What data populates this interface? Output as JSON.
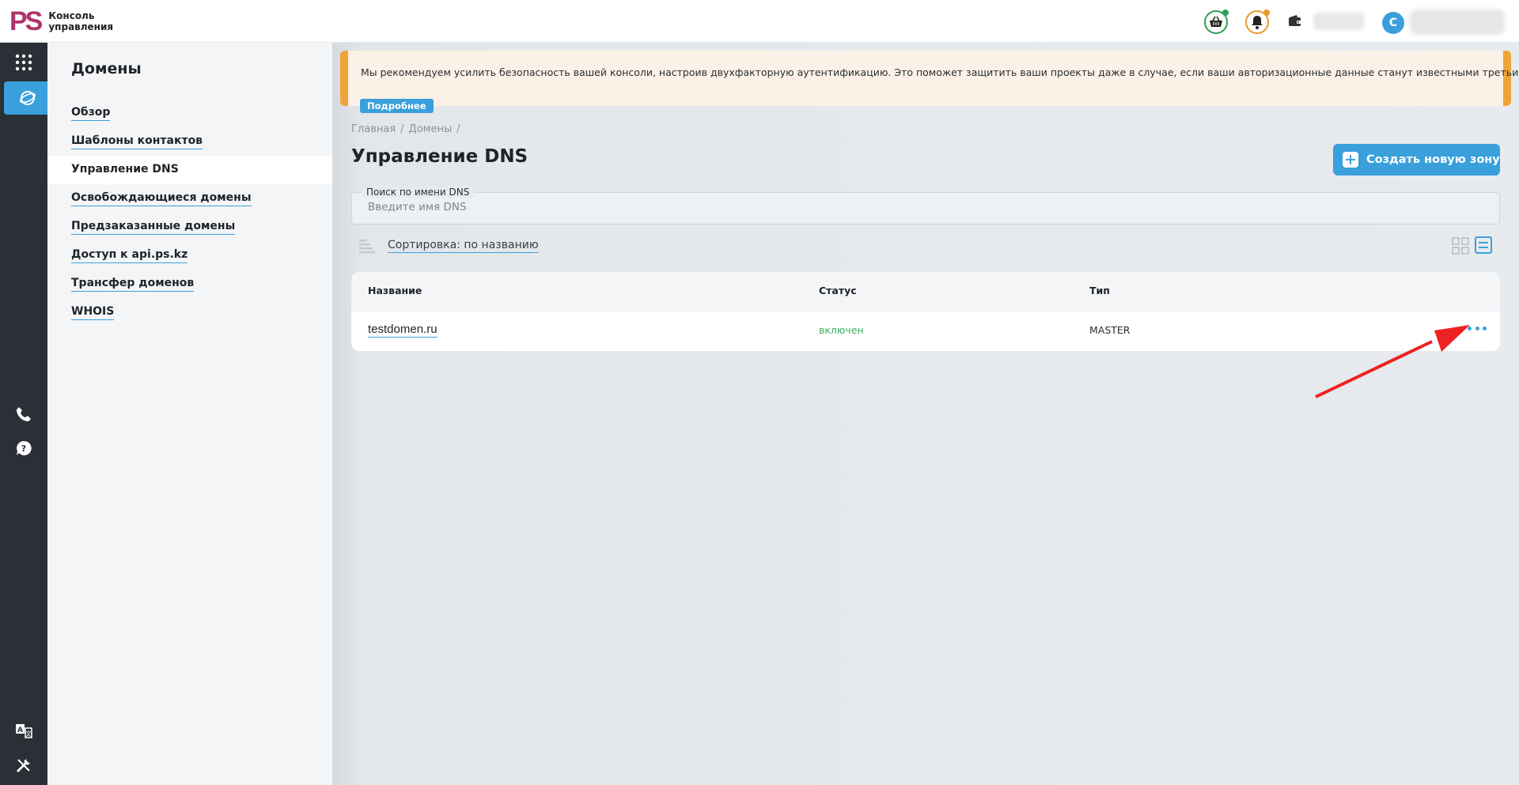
{
  "header": {
    "logo_mark": "PS",
    "logo_line1": "Консоль",
    "logo_line2": "управления",
    "avatar_initial": "С",
    "icons": [
      "basket-icon",
      "bell-icon",
      "wallet-icon"
    ],
    "basket_badge_color": "#2f9e55",
    "bell_badge_color": "#e89a2b"
  },
  "rail": {
    "items": [
      "apps-grid-icon",
      "domains-globe-icon",
      "phone-icon",
      "help-icon",
      "translate-icon",
      "tools-icon"
    ]
  },
  "sidebar": {
    "title": "Домены",
    "items": [
      {
        "label": "Обзор"
      },
      {
        "label": "Шаблоны контактов"
      },
      {
        "label": "Управление DNS",
        "active": true
      },
      {
        "label": "Освобождающиеся домены"
      },
      {
        "label": "Предзаказанные домены"
      },
      {
        "label": "Доступ к api.ps.kz"
      },
      {
        "label": "Трансфер доменов"
      },
      {
        "label": "WHOIS"
      }
    ]
  },
  "banner": {
    "text": "Мы рекомендуем усилить безопасность вашей консоли, настроив двухфакторную аутентификацию. Это поможет защитить ваши проекты даже в случае, если ваши авторизационные данные станут известными третьим лицам.",
    "button": "Подробнее"
  },
  "breadcrumb": {
    "items": [
      "Главная",
      "Домены"
    ]
  },
  "page": {
    "title": "Управление DNS",
    "create_button": "Создать новую зону"
  },
  "search": {
    "label": "Поиск по имени DNS",
    "placeholder": "Введите имя DNS",
    "value": ""
  },
  "sort": {
    "label": "Сортировка: по названию"
  },
  "table": {
    "columns": [
      "Название",
      "Статус",
      "Тип"
    ],
    "rows": [
      {
        "name": "testdomen.ru",
        "status": "включен",
        "type": "MASTER"
      }
    ]
  },
  "colors": {
    "accent": "#3aa0dc",
    "brand": "#b0346d",
    "warning": "#efa43a",
    "status_ok": "#3cae5c",
    "annotation_arrow": "#ee2222"
  }
}
